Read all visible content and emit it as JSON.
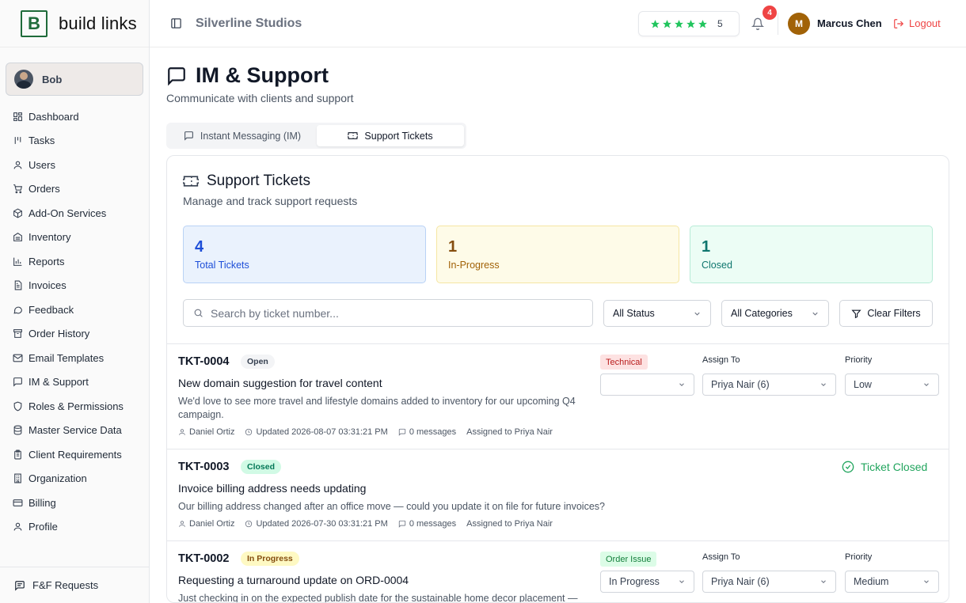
{
  "brand": {
    "logo_letter": "B",
    "name": "build links"
  },
  "sidebar": {
    "user": "Bob",
    "items": [
      {
        "label": "Dashboard",
        "icon": "grid-icon"
      },
      {
        "label": "Tasks",
        "icon": "tasks-icon"
      },
      {
        "label": "Users",
        "icon": "user-icon"
      },
      {
        "label": "Orders",
        "icon": "cart-icon"
      },
      {
        "label": "Add-On Services",
        "icon": "package-icon"
      },
      {
        "label": "Inventory",
        "icon": "inventory-icon"
      },
      {
        "label": "Reports",
        "icon": "bar-chart-icon"
      },
      {
        "label": "Invoices",
        "icon": "invoice-icon"
      },
      {
        "label": "Feedback",
        "icon": "feedback-icon"
      },
      {
        "label": "Order History",
        "icon": "archive-icon"
      },
      {
        "label": "Email Templates",
        "icon": "mail-icon"
      },
      {
        "label": "IM & Support",
        "icon": "message-icon"
      },
      {
        "label": "Roles & Permissions",
        "icon": "shield-icon"
      },
      {
        "label": "Master Service Data",
        "icon": "database-icon"
      },
      {
        "label": "Client Requirements",
        "icon": "clipboard-icon"
      },
      {
        "label": "Organization",
        "icon": "building-icon"
      },
      {
        "label": "Billing",
        "icon": "credit-card-icon"
      },
      {
        "label": "Profile",
        "icon": "user-icon"
      }
    ],
    "footer": "F&F Requests"
  },
  "header": {
    "company": "Silverline Studios",
    "rating": "5",
    "notifications": "4",
    "user_initial": "M",
    "user_name": "Marcus Chen",
    "logout": "Logout"
  },
  "page": {
    "title": "IM & Support",
    "subtitle": "Communicate with clients and support",
    "tabs": [
      "Instant Messaging (IM)",
      "Support Tickets"
    ]
  },
  "card": {
    "title": "Support Tickets",
    "subtitle": "Manage and track support requests",
    "stats": [
      {
        "value": "4",
        "label": "Total Tickets"
      },
      {
        "value": "1",
        "label": "In-Progress"
      },
      {
        "value": "1",
        "label": "Closed"
      }
    ],
    "search_placeholder": "Search by ticket number...",
    "filter_status": "All Status",
    "filter_category": "All Categories",
    "clear_filters": "Clear Filters"
  },
  "labels": {
    "assign_to": "Assign To",
    "priority": "Priority",
    "ticket_closed": "Ticket Closed"
  },
  "tickets": [
    {
      "id": "TKT-0004",
      "status": "Open",
      "category": "Technical",
      "title": "New domain suggestion for travel content",
      "description": "We'd love to see more travel and lifestyle domains added to inventory for our upcoming Q4 campaign.",
      "author": "Daniel Ortiz",
      "updated": "Updated 2026-08-07 03:31:21 PM",
      "messages": "0 messages",
      "assigned": "Assigned to Priya Nair",
      "status_select": "",
      "assign_select": "Priya Nair (6)",
      "priority_select": "Low"
    },
    {
      "id": "TKT-0003",
      "status": "Closed",
      "title": "Invoice billing address needs updating",
      "description": "Our billing address changed after an office move — could you update it on file for future invoices?",
      "author": "Daniel Ortiz",
      "updated": "Updated 2026-07-30 03:31:21 PM",
      "messages": "0 messages",
      "assigned": "Assigned to Priya Nair"
    },
    {
      "id": "TKT-0002",
      "status": "In Progress",
      "category": "Order Issue",
      "title": "Requesting a turnaround update on ORD-0004",
      "description": "Just checking in on the expected publish date for the sustainable home decor placement —",
      "status_select": "In Progress",
      "assign_select": "Priya Nair (6)",
      "priority_select": "Medium"
    }
  ],
  "colors": {
    "brand_green": "#1f6b3a",
    "star": "#22c55e",
    "danger": "#ef4444"
  }
}
